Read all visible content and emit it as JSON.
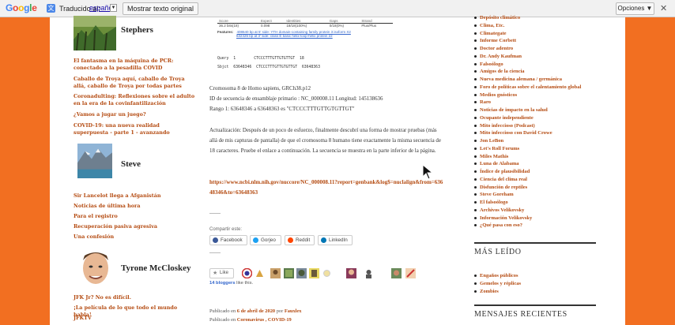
{
  "gbar": {
    "logo": "Google",
    "translated_label": "Traducido al:",
    "language": "español",
    "show_original": "Mostrar texto original",
    "options": "Opciones ▼",
    "close": "✕"
  },
  "left": {
    "authors": [
      {
        "name": "Stephers"
      },
      {
        "name": "Steve"
      },
      {
        "name": "Tyrone McCloskey"
      }
    ],
    "stephers_links": [
      "El fantasma en la máquina de PCR: conectado a la pesadilla COVID",
      "Caballo de Troya aquí, caballo de Troya allá, caballo de Troya por todas partes",
      "Coronadulting: Reflexiones sobre el adulto en la era de la covinfantilización",
      "¿Vamos a jugar un juego?",
      "COVID-19: una nueva realidad superpuesta - parte 1 - avanzando"
    ],
    "steve_links": [
      "Sir Lancelot llega a Afganistán",
      "Noticias de última hora",
      "Para el registro",
      "Recuperación pasiva agresiva",
      "Una confesión"
    ],
    "tyrone_links": [
      "JFK Jr? No es difícil.",
      "¡La película de lo que todo el mundo habla!",
      "JFKTV"
    ]
  },
  "blast": {
    "headers": [
      "Score",
      "Expect",
      "Identities",
      "Gaps",
      "Strand"
    ],
    "values": [
      "36.2 bits(18)",
      "0.098",
      "18/18(100%)",
      "0/18(0%)",
      "Plus/Plus"
    ],
    "features_label": "Features:",
    "features": [
      "408640 bp at 5' side: YTH domain-containing family protein 3 isoform X2",
      "632426 bp at 3' side: class E basic helix-loop-helix protein 22"
    ],
    "query": "Query  1        CTCCCTTTGTTGTGTTGT  18",
    "sbjct": "Sbjct  63648346  CTCCCTTTGTTGTGTTGT  63648363"
  },
  "post": {
    "line1": "Cromosoma 8 de Homo sapiens, GRCh38.p12",
    "line2": "ID de secuencia de ensamblaje primario : NC_000008.11 Longitud: 145138636",
    "line3": "Rango 1: 63648346 a 63648363 es \"CTCCCTTTGTTGTGTTGT\"",
    "para": "Actualización: Después de un poco de esfuerzo, finalmente descubrí una forma de mostrar pruebas (más allá de mis capturas de pantalla) de que el cromosoma 8 humano tiene exactamente la misma secuencia de 18 caracteres. Pruebe el enlace a continuación. La secuencia se muestra en la parte inferior de la página.",
    "url": "https://www.ncbi.nlm.nih.gov/nuccore/NC_000008.11?report=genbank&log$=nuclalign&from=63648346&to=63648363"
  },
  "share": {
    "label": "Compartir este:",
    "buttons": [
      "Facebook",
      "Gorjeo",
      "Reddit",
      "LinkedIn"
    ],
    "colors": [
      "#3b5998",
      "#1da1f2",
      "#ff4500",
      "#0077b5"
    ]
  },
  "likes": {
    "button": "Like",
    "text_count": "14 bloggers",
    "text_rest": " like this."
  },
  "meta": {
    "published_prefix": "Publicado en ",
    "date": "6 de abril de 2020",
    "by": "por ",
    "author": "Fauxlex",
    "cat_prefix": "Publicado en ",
    "categories": "Coronavirus , COVID-19"
  },
  "right": {
    "links": [
      "Depósito climático",
      "Clima, Etc.",
      "Climategate",
      "Informe Corbett",
      "Doctor adentro",
      "Dr. Andy Kaufman",
      "Falsoólogo",
      "Amigos de la ciencia",
      "Nueva medicina alemana / germánica",
      "Foro de políticas sobre el calentamiento global",
      "Medios gnósticos",
      "Raro",
      "Noticias de impacto en la salud",
      "Ocupante independiente",
      "Mito infeccioso (Podcast)",
      "Mito infeccioso con David Crowe",
      "Jon LeBon",
      "Let's Roll Forums",
      "Miles Mathis",
      "Luna de Alabama",
      "Índice de plausibilidad",
      "Ciencia del clima real",
      "Disfunción de reptiles",
      "Steve Goreham",
      "El falsoólogo",
      "Archivos Velikovsky",
      "Información Velikovsky",
      "¿Qué pasa con eso?"
    ],
    "most_read_title": "MÁS LEÍDO",
    "most_read": [
      "Engaños públicos",
      "Gemelos y réplicas",
      "Zombies"
    ],
    "recent_title": "MENSAJES RECIENTES"
  }
}
